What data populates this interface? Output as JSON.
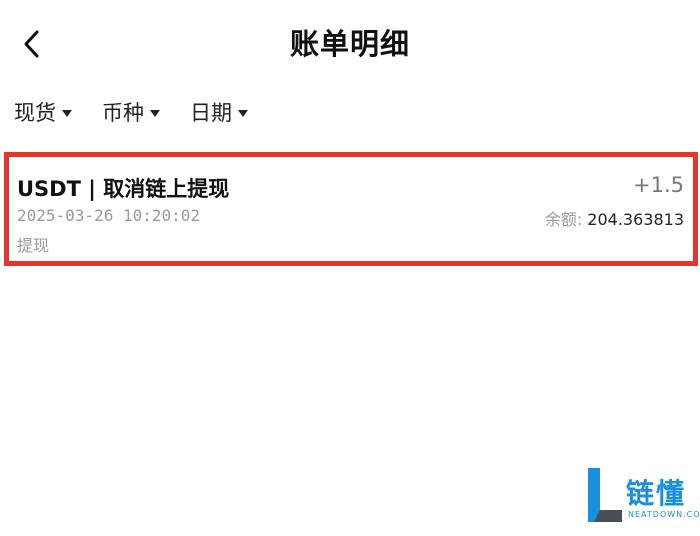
{
  "header": {
    "title": "账单明细",
    "back_icon": "chevron-left-icon"
  },
  "filters": [
    {
      "label": "现货",
      "icon": "caret-down-icon"
    },
    {
      "label": "币种",
      "icon": "caret-down-icon"
    },
    {
      "label": "日期",
      "icon": "caret-down-icon"
    }
  ],
  "records": [
    {
      "title": "USDT | 取消链上提现",
      "amount": "+1.5",
      "time": "2025-03-26 10:20:02",
      "balance_label": "余额: ",
      "balance_value": "204.363813",
      "type": "提现"
    }
  ],
  "highlight_color": "#e3372b",
  "watermark": {
    "text": "链懂",
    "sub": "NEATDOWN.COM",
    "color": "#1a8fe0"
  }
}
